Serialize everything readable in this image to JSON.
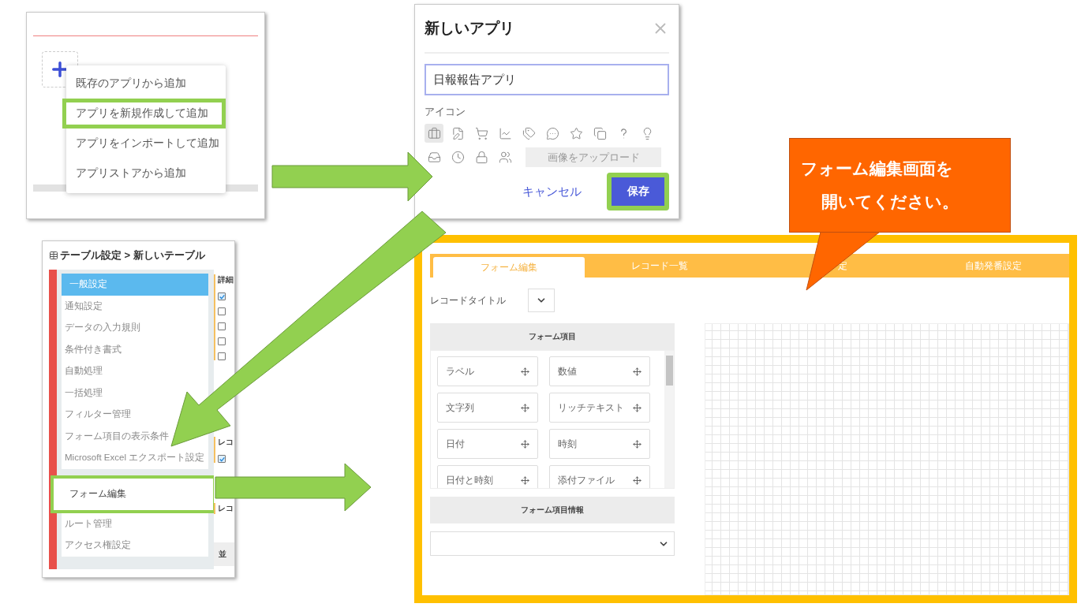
{
  "add_menu_panel": {
    "items": [
      {
        "label": "既存のアプリから追加",
        "highlighted": false
      },
      {
        "label": "アプリを新規作成して追加",
        "highlighted": true
      },
      {
        "label": "アプリをインポートして追加",
        "highlighted": false
      },
      {
        "label": "アプリストアから追加",
        "highlighted": false
      }
    ]
  },
  "new_app_dialog": {
    "title": "新しいアプリ",
    "name_value": "日報報告アプリ",
    "icon_label": "アイコン",
    "icon_options": [
      {
        "selected": true
      },
      {
        "selected": false
      },
      {
        "selected": false
      },
      {
        "selected": false
      },
      {
        "selected": false
      },
      {
        "selected": false
      },
      {
        "selected": false
      },
      {
        "selected": false
      },
      {
        "selected": false
      },
      {
        "selected": false
      },
      {
        "selected": false
      },
      {
        "selected": false
      },
      {
        "selected": false
      },
      {
        "selected": false
      }
    ],
    "upload_button": "画像をアップロード",
    "cancel_button": "キャンセル",
    "save_button": {
      "label": "保存",
      "highlighted": true
    }
  },
  "table_settings_panel": {
    "breadcrumb": "テーブル設定 > 新しいテーブル",
    "menu_groups": [
      [
        {
          "label": "一般設定",
          "selected": true,
          "muted": false,
          "highlighted": false
        },
        {
          "label": "通知設定",
          "selected": false,
          "muted": true,
          "highlighted": false
        },
        {
          "label": "データの入力規則",
          "selected": false,
          "muted": true,
          "highlighted": false
        },
        {
          "label": "条件付き書式",
          "selected": false,
          "muted": true,
          "highlighted": false
        },
        {
          "label": "自動処理",
          "selected": false,
          "muted": true,
          "highlighted": false
        },
        {
          "label": "一括処理",
          "selected": false,
          "muted": true,
          "highlighted": false
        },
        {
          "label": "フィルター管理",
          "selected": false,
          "muted": true,
          "highlighted": false
        },
        {
          "label": "フォーム項目の表示条件",
          "selected": false,
          "muted": true,
          "highlighted": false
        },
        {
          "label": "Microsoft Excel エクスポート設定",
          "selected": false,
          "muted": true,
          "highlighted": false
        }
      ],
      [
        {
          "label": "フォーム編集",
          "selected": false,
          "muted": false,
          "highlighted": true
        },
        {
          "label": "ルート管理",
          "selected": false,
          "muted": true,
          "highlighted": false
        },
        {
          "label": "アクセス権設定",
          "selected": false,
          "muted": true,
          "highlighted": false
        }
      ]
    ],
    "sections": [
      {
        "label": "詳細",
        "checkboxes": [
          true,
          false,
          false,
          false,
          false
        ]
      },
      {
        "label": "レコ",
        "checkboxes": [
          true
        ]
      },
      {
        "label": "レコ"
      }
    ],
    "footer_button": "並"
  },
  "form_editor": {
    "tabs": [
      {
        "label": "フォーム編集",
        "selected": true
      },
      {
        "label": "レコード一覧",
        "selected": false
      },
      {
        "label": "定",
        "selected": false
      },
      {
        "label": "自動発番設定",
        "selected": false
      }
    ],
    "record_title_label": "レコードタイトル",
    "form_items_header": "フォーム項目",
    "form_items": [
      "ラベル",
      "数値",
      "文字列",
      "リッチテキスト",
      "日付",
      "時刻",
      "日付と時刻",
      "添付ファイル"
    ],
    "info_header": "フォーム項目情報"
  },
  "callout": {
    "lines": [
      "フォーム編集画面を",
      "開いてください。"
    ]
  }
}
